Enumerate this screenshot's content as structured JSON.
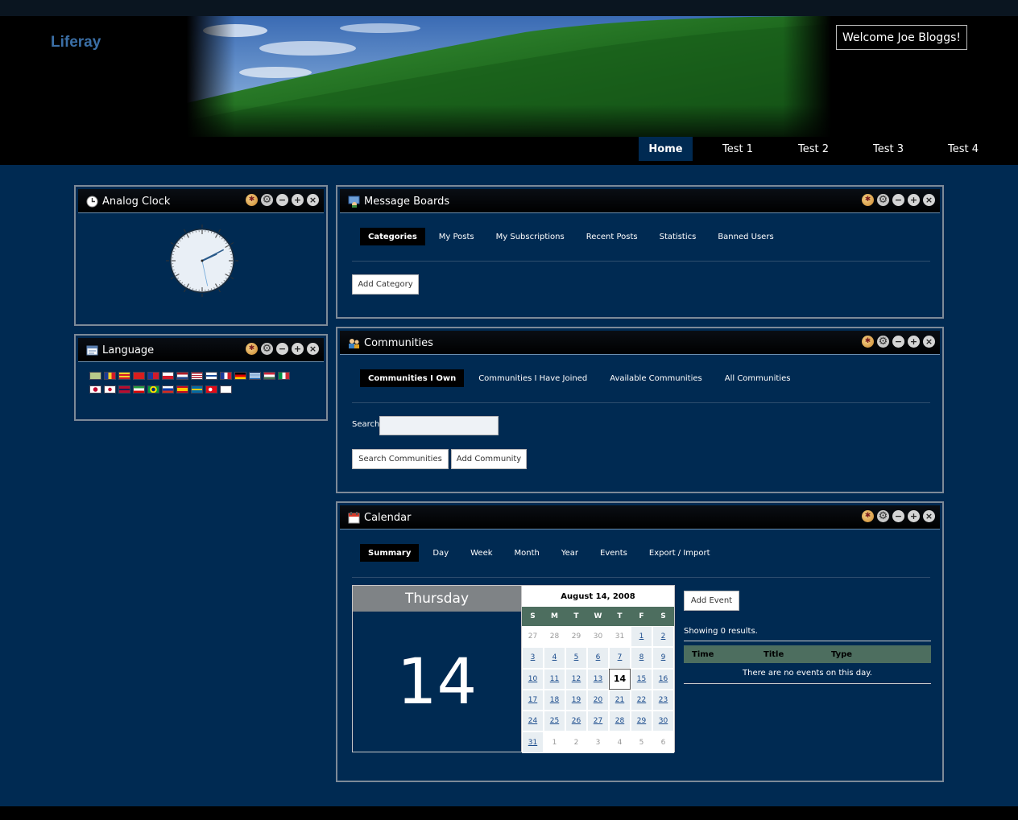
{
  "header": {
    "logo": "Liferay",
    "welcome": "Welcome Joe Bloggs!"
  },
  "nav": [
    "Home",
    "Test 1",
    "Test 2",
    "Test 3",
    "Test 4"
  ],
  "clock": {
    "title": "Analog Clock",
    "hour": 2,
    "minute": 10,
    "second": 28
  },
  "language": {
    "title": "Language",
    "flags_row1": [
      "ar",
      "ca-ad",
      "ca-es",
      "zh-cn",
      "zh-tw",
      "cs",
      "nl",
      "en",
      "fi",
      "fr",
      "de",
      "el",
      "hu",
      "it"
    ],
    "flags_row2": [
      "ja",
      "ko",
      "nb",
      "fa",
      "pt",
      "ru",
      "es",
      "sv",
      "tr",
      "vi"
    ]
  },
  "message_boards": {
    "title": "Message Boards",
    "tabs": [
      "Categories",
      "My Posts",
      "My Subscriptions",
      "Recent Posts",
      "Statistics",
      "Banned Users"
    ],
    "add_button": "Add Category"
  },
  "communities": {
    "title": "Communities",
    "tabs": [
      "Communities I Own",
      "Communities I Have Joined",
      "Available Communities",
      "All Communities"
    ],
    "search_label": "Search",
    "search_value": "",
    "search_button": "Search Communities",
    "add_button": "Add Community"
  },
  "calendar": {
    "title": "Calendar",
    "tabs": [
      "Summary",
      "Day",
      "Week",
      "Month",
      "Year",
      "Events",
      "Export / Import"
    ],
    "day_name": "Thursday",
    "day_number": "14",
    "month_title": "August 14, 2008",
    "weekdays": [
      "S",
      "M",
      "T",
      "W",
      "T",
      "F",
      "S"
    ],
    "grid": [
      [
        "27",
        "28",
        "29",
        "30",
        "31",
        "1",
        "2"
      ],
      [
        "3",
        "4",
        "5",
        "6",
        "7",
        "8",
        "9"
      ],
      [
        "10",
        "11",
        "12",
        "13",
        "14",
        "15",
        "16"
      ],
      [
        "17",
        "18",
        "19",
        "20",
        "21",
        "22",
        "23"
      ],
      [
        "24",
        "25",
        "26",
        "27",
        "28",
        "29",
        "30"
      ],
      [
        "31",
        "1",
        "2",
        "3",
        "4",
        "5",
        "6"
      ]
    ],
    "today": "14",
    "add_event": "Add Event",
    "showing": "Showing 0 results.",
    "columns": [
      "Time",
      "Title",
      "Type"
    ],
    "empty": "There are no events on this day."
  },
  "colors": {
    "background": "#002A52",
    "header": "#000000",
    "logo": "#3B6FA6",
    "calendar_header": "#4D6E5F"
  },
  "controls": {
    "look_icon": "look-and-feel-icon",
    "config_icon": "configuration-icon",
    "minimize_icon": "minimize-icon",
    "maximize_icon": "maximize-icon",
    "close_icon": "close-icon"
  }
}
